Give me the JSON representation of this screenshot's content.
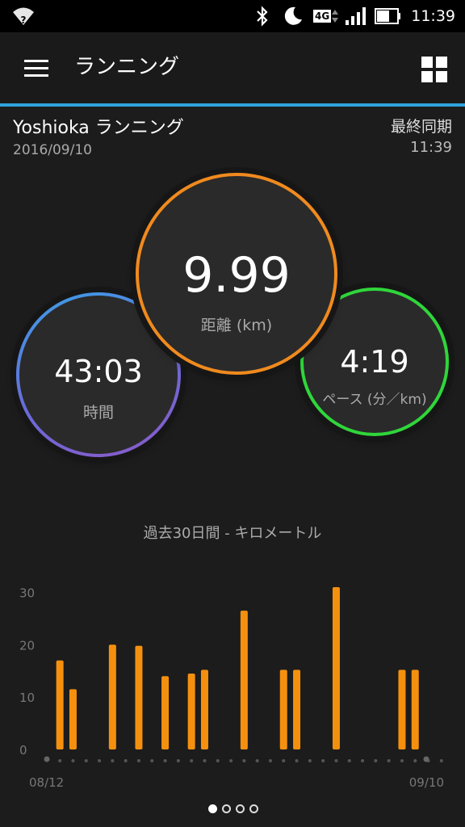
{
  "status_bar": {
    "time": "11:39",
    "network": "4G",
    "icons": [
      "wifi-unknown-icon",
      "bluetooth-icon",
      "moon-icon",
      "4g-icon",
      "signal-icon",
      "battery-icon"
    ]
  },
  "app_bar": {
    "title": "ランニング",
    "accent_color": "#2ea3dc",
    "icons": [
      "hamburger-menu-icon",
      "grid-icon"
    ]
  },
  "device": {
    "name": "Yoshioka ランニング",
    "date": "2016/09/10",
    "sync_label": "最終同期",
    "sync_time": "11:39"
  },
  "stats": {
    "time": {
      "value": "43:03",
      "label": "時間"
    },
    "distance": {
      "value": "9.99",
      "label": "距離 (km)",
      "color": "#f08a1e"
    },
    "pace": {
      "value": "4:19",
      "label": "ペース (分／km)",
      "color": "#2fd63a"
    }
  },
  "chart_data": {
    "type": "bar",
    "title": "過去30日間 - キロメートル",
    "x_start_label": "08/12",
    "x_end_label": "09/10",
    "ylim": [
      0,
      33
    ],
    "yticks": [
      0,
      10,
      20,
      30
    ],
    "bar_color": "#f5900f",
    "values": [
      17,
      11.5,
      0,
      0,
      20,
      0,
      19.8,
      0,
      14,
      0,
      14.5,
      15.2,
      0,
      0,
      26.5,
      0,
      0,
      15.2,
      15.2,
      0,
      0,
      31,
      0,
      0,
      0,
      0,
      15.2,
      15.2,
      0,
      0
    ]
  },
  "pager": {
    "count": 4,
    "active": 0
  }
}
